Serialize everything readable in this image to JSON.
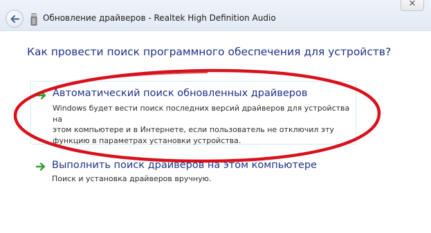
{
  "window": {
    "title": "Обновление драйверов - Realtek High Definition Audio",
    "close_label": "✕"
  },
  "content": {
    "heading": "Как провести поиск программного обеспечения для устройств?",
    "options": [
      {
        "title": "Автоматический поиск обновленных драйверов",
        "description": "Windows будет вести поиск последних версий драйверов для устройства на\nэтом компьютере и в Интернете, если пользователь не отключил эту\nфункцию в параметрах установки устройства."
      },
      {
        "title": "Выполнить поиск драйверов на этом компьютере",
        "description": "Поиск и установка драйверов вручную."
      }
    ]
  },
  "icons": {
    "back": "back-arrow-icon",
    "device": "usb-device-icon",
    "option_arrow": "green-arrow-icon"
  },
  "colors": {
    "link_blue": "#1e3287",
    "arrow_green": "#2f9e2f",
    "annotation_red": "#d8111c",
    "option_border": "#d2e9f6"
  }
}
